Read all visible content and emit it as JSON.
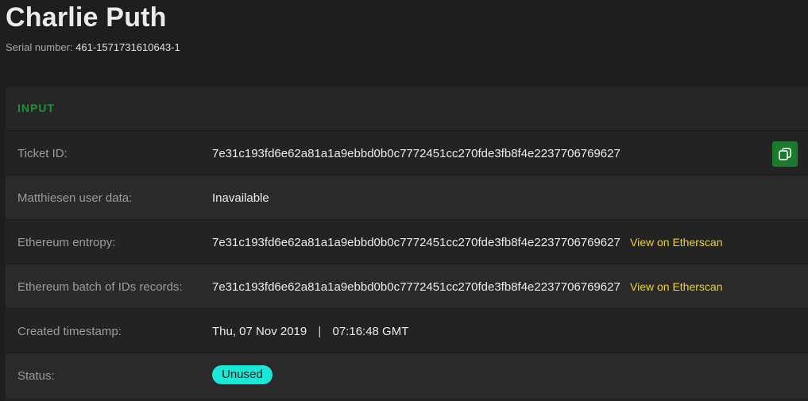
{
  "header": {
    "title": "Charlie Puth",
    "serial_label": "Serial number:",
    "serial_value": "461-1571731610643-1"
  },
  "section": {
    "label": "INPUT"
  },
  "rows": {
    "ticket_id": {
      "label": "Ticket ID:",
      "value": "7e31c193fd6e62a81a1a9ebbd0b0c7772451cc270fde3fb8f4e2237706769627",
      "copy_icon": "copy-icon"
    },
    "user_data": {
      "label": "Matthiesen user data:",
      "value": "Inavailable"
    },
    "entropy": {
      "label": "Ethereum entropy:",
      "value": "7e31c193fd6e62a81a1a9ebbd0b0c7772451cc270fde3fb8f4e2237706769627",
      "link": "View on Etherscan"
    },
    "batch": {
      "label": "Ethereum batch of IDs records:",
      "value": "7e31c193fd6e62a81a1a9ebbd0b0c7772451cc270fde3fb8f4e2237706769627",
      "link": "View on Etherscan"
    },
    "timestamp": {
      "label": "Created timestamp:",
      "date": "Thu, 07 Nov 2019",
      "separator": "|",
      "time": "07:16:48 GMT"
    },
    "status": {
      "label": "Status:",
      "value": "Unused"
    }
  },
  "colors": {
    "background": "#1e1e1e",
    "accent_green": "#1f9138",
    "link_yellow": "#f2d416",
    "status_badge": "#19e8d6"
  }
}
